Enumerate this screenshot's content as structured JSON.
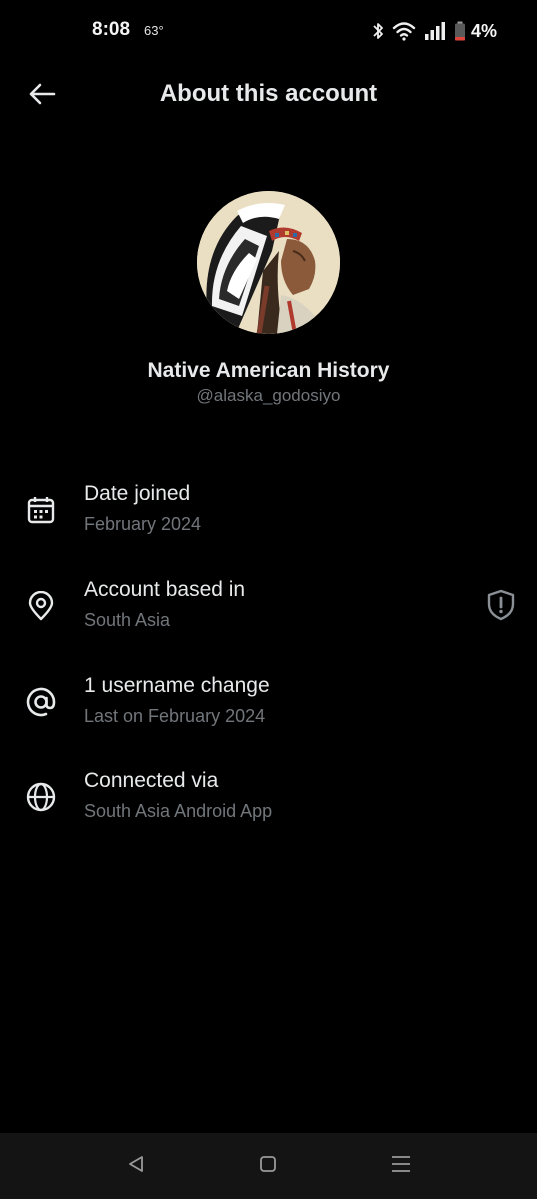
{
  "status_bar": {
    "time": "8:08",
    "temperature": "63°",
    "battery_percent": "4%",
    "icons": [
      "bluetooth-icon",
      "wifi-icon",
      "signal-icon",
      "battery-icon"
    ]
  },
  "header": {
    "title": "About this account",
    "back_icon": "arrow-left-icon"
  },
  "profile": {
    "display_name": "Native American History",
    "handle": "@alaska_godosiyo",
    "avatar_description": "portrait with feathered headdress"
  },
  "info_rows": [
    {
      "icon": "calendar-icon",
      "title": "Date joined",
      "subtitle": "February 2024"
    },
    {
      "icon": "location-pin-icon",
      "title": "Account based in",
      "subtitle": "South Asia",
      "trailing_icon": "shield-icon"
    },
    {
      "icon": "at-sign-icon",
      "title": "1 username change",
      "subtitle": "Last on February 2024"
    },
    {
      "icon": "globe-icon",
      "title": "Connected via",
      "subtitle": "South Asia Android App"
    }
  ],
  "nav_bar": {
    "buttons": [
      "back-triangle-icon",
      "home-square-icon",
      "recents-menu-icon"
    ]
  },
  "colors": {
    "background": "#000000",
    "primary_text": "#e7e9ea",
    "secondary_text": "#71767b",
    "battery_low": "#e0473b",
    "nav_background": "#141414"
  }
}
